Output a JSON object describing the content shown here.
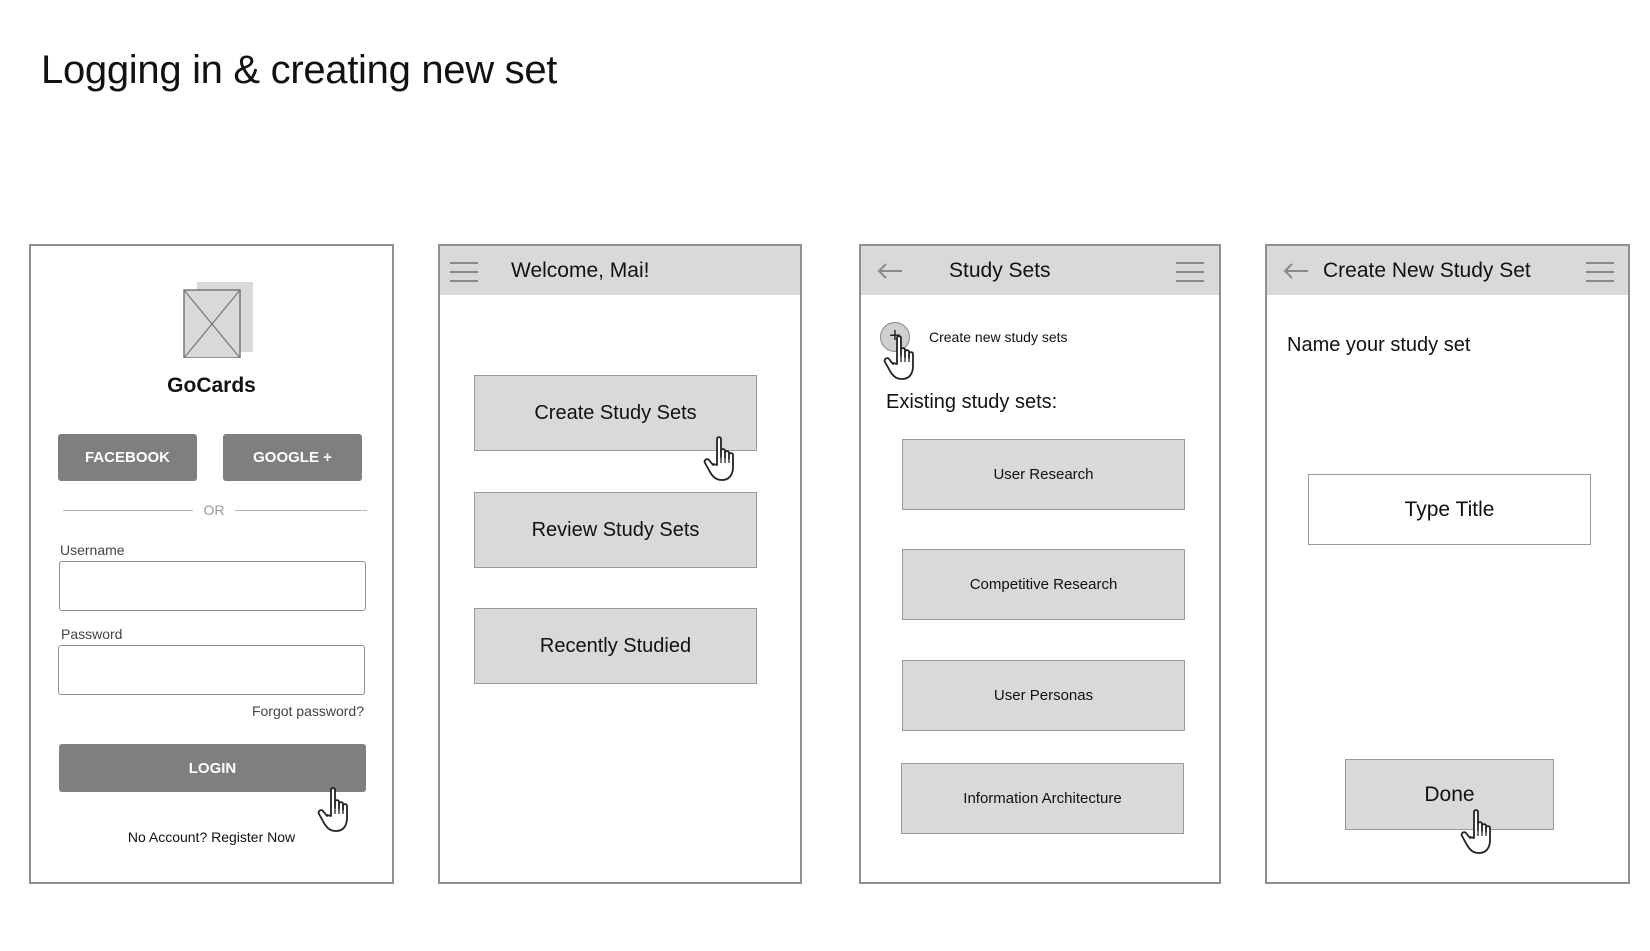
{
  "page": {
    "title": "Logging in & creating new set"
  },
  "login": {
    "app_name": "GoCards",
    "logo_icon": "image-placeholder-icon",
    "facebook_label": "FACEBOOK",
    "google_label": "GOOGLE +",
    "or_label": "OR",
    "username_label": "Username",
    "username_value": "",
    "password_label": "Password",
    "password_value": "",
    "forgot_label": "Forgot password?",
    "login_label": "LOGIN",
    "register_label": "No Account? Register Now"
  },
  "home": {
    "title": "Welcome, Mai!",
    "buttons": [
      "Create Study Sets",
      "Review Study Sets",
      "Recently Studied"
    ]
  },
  "study_sets": {
    "title": "Study Sets",
    "create_label": "Create new study sets",
    "existing_label": "Existing study sets:",
    "sets": [
      "User Research",
      "Competitive Research",
      "User Personas",
      "Information Architecture"
    ]
  },
  "new_set": {
    "title": "Create New Study Set",
    "prompt": "Name your study set",
    "title_placeholder": "Type Title",
    "done_label": "Done"
  },
  "colors": {
    "bar": "#d9d9d9",
    "button_dark": "#7f7f7f",
    "border": "#8f8f8f"
  }
}
